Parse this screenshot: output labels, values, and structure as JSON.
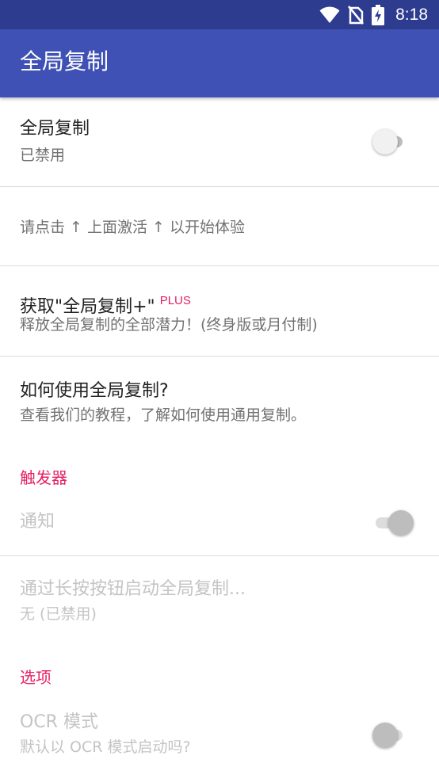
{
  "status_bar": {
    "time": "8:18",
    "icons": [
      "wifi-icon",
      "no-sim-icon",
      "battery-charging-icon"
    ]
  },
  "app_bar": {
    "title": "全局复制"
  },
  "preferences": {
    "global_copy": {
      "title": "全局复制",
      "summary": "已禁用",
      "enabled": false
    },
    "activate_hint": {
      "text": "请点击 ↑ 上面激活 ↑ 以开始体验"
    },
    "get_plus": {
      "title": "获取\"全局复制+\"",
      "badge": "PLUS",
      "summary": "释放全局复制的全部潜力！(终身版或月付制)"
    },
    "how_to_use": {
      "title": "如何使用全局复制?",
      "summary": "查看我们的教程，了解如何使用通用复制。"
    }
  },
  "trigger_category": {
    "label": "触发器",
    "notification": {
      "title": "通知",
      "enabled": true,
      "disabled_state": true
    },
    "long_press": {
      "title": "通过长按按钮启动全局复制...",
      "summary": "无 (已禁用)"
    }
  },
  "options_category": {
    "label": "选项",
    "ocr_mode": {
      "title": "OCR 模式",
      "summary": "默认以 OCR 模式启动吗?",
      "enabled": false
    }
  },
  "colors": {
    "status_bar": "#2e3c8f",
    "primary": "#3f51b5",
    "accent": "#e91e63",
    "divider": "#dcdcdc"
  }
}
